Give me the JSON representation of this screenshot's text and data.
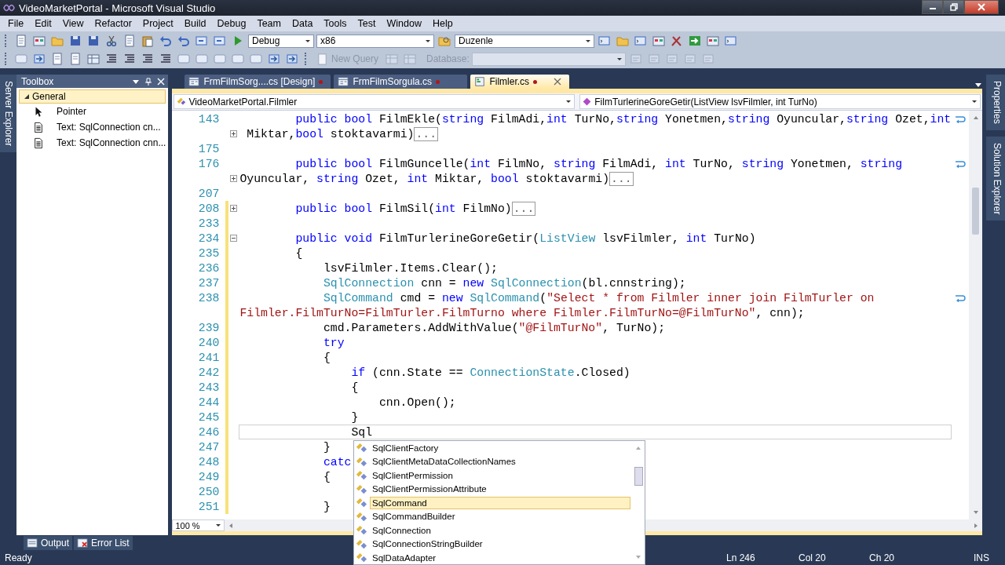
{
  "window": {
    "title": "VideoMarketPortal - Microsoft Visual Studio"
  },
  "menu": [
    "File",
    "Edit",
    "View",
    "Refactor",
    "Project",
    "Build",
    "Debug",
    "Team",
    "Data",
    "Tools",
    "Test",
    "Window",
    "Help"
  ],
  "toolbar": {
    "configuration": "Debug",
    "platform": "x86",
    "find": "Duzenle",
    "new_query": "New Query",
    "database_label": "Database:"
  },
  "side_left": [
    "Server Explorer"
  ],
  "toolbox": {
    "title": "Toolbox",
    "group": {
      "label": "General",
      "expanded": true
    },
    "items": [
      {
        "kind": "pointer",
        "label": "Pointer"
      },
      {
        "kind": "text",
        "label": "Text:  SqlConnection cn..."
      },
      {
        "kind": "text",
        "label": "Text: SqlConnection cnn..."
      }
    ]
  },
  "tabs": [
    {
      "label": "FrmFilmSorg....cs [Design]",
      "kind": "designer",
      "selected": false,
      "modified": true
    },
    {
      "label": "FrmFilmSorgula.cs",
      "kind": "designer",
      "selected": false,
      "modified": true
    },
    {
      "label": "Filmler.cs",
      "kind": "code",
      "selected": true,
      "modified": true
    }
  ],
  "nav": {
    "type": "VideoMarketPortal.Filmler",
    "member": "FilmTurlerineGoreGetir(ListView lsvFilmler, int TurNo)"
  },
  "code": [
    {
      "number": "143",
      "changed": false,
      "current": false,
      "wrapped": true,
      "segments": [
        {
          "kind": "keyword",
          "text": "        public bool"
        },
        {
          "kind": "plain",
          "text": " FilmEkle("
        },
        {
          "kind": "keyword",
          "text": "string"
        },
        {
          "kind": "plain",
          "text": " FilmAdi,"
        },
        {
          "kind": "keyword",
          "text": "int"
        },
        {
          "kind": "plain",
          "text": " TurNo,"
        },
        {
          "kind": "keyword",
          "text": "string"
        },
        {
          "kind": "plain",
          "text": " Yonetmen,"
        },
        {
          "kind": "keyword",
          "text": "string"
        },
        {
          "kind": "plain",
          "text": " Oyuncular,"
        },
        {
          "kind": "keyword",
          "text": "string"
        },
        {
          "kind": "plain",
          "text": " Ozet,"
        },
        {
          "kind": "keyword",
          "text": "int"
        }
      ]
    },
    {
      "expanded": false,
      "changed": false,
      "current": false,
      "wrapped": false,
      "segments": [
        {
          "kind": "plain",
          "text": " Miktar,"
        },
        {
          "kind": "keyword",
          "text": "bool"
        },
        {
          "kind": "plain",
          "text": " stoktavarmi)"
        },
        {
          "kind": "collapsed",
          "text": "..."
        }
      ]
    },
    {
      "number": "175",
      "changed": false,
      "current": false,
      "wrapped": false
    },
    {
      "number": "176",
      "changed": false,
      "current": false,
      "wrapped": true,
      "segments": [
        {
          "kind": "keyword",
          "text": "        public bool"
        },
        {
          "kind": "plain",
          "text": " FilmGuncelle("
        },
        {
          "kind": "keyword",
          "text": "int"
        },
        {
          "kind": "plain",
          "text": " FilmNo, "
        },
        {
          "kind": "keyword",
          "text": "string"
        },
        {
          "kind": "plain",
          "text": " FilmAdi, "
        },
        {
          "kind": "keyword",
          "text": "int"
        },
        {
          "kind": "plain",
          "text": " TurNo, "
        },
        {
          "kind": "keyword",
          "text": "string"
        },
        {
          "kind": "plain",
          "text": " Yonetmen, "
        },
        {
          "kind": "keyword",
          "text": "string"
        }
      ]
    },
    {
      "expanded": false,
      "changed": false,
      "current": false,
      "wrapped": false,
      "segments": [
        {
          "kind": "plain",
          "text": "Oyuncular, "
        },
        {
          "kind": "keyword",
          "text": "string"
        },
        {
          "kind": "plain",
          "text": " Ozet, "
        },
        {
          "kind": "keyword",
          "text": "int"
        },
        {
          "kind": "plain",
          "text": " Miktar, "
        },
        {
          "kind": "keyword",
          "text": "bool"
        },
        {
          "kind": "plain",
          "text": " stoktavarmi)"
        },
        {
          "kind": "collapsed",
          "text": "..."
        }
      ]
    },
    {
      "number": "207",
      "changed": false,
      "current": false,
      "wrapped": false
    },
    {
      "number": "208",
      "expanded": false,
      "changed": true,
      "current": false,
      "wrapped": false,
      "segments": [
        {
          "kind": "keyword",
          "text": "        public bool"
        },
        {
          "kind": "plain",
          "text": " FilmSil("
        },
        {
          "kind": "keyword",
          "text": "int"
        },
        {
          "kind": "plain",
          "text": " FilmNo)"
        },
        {
          "kind": "collapsed",
          "text": "..."
        }
      ]
    },
    {
      "number": "233",
      "changed": true,
      "current": false,
      "wrapped": false
    },
    {
      "number": "234",
      "expanded": true,
      "changed": true,
      "current": false,
      "wrapped": false,
      "segments": [
        {
          "kind": "keyword",
          "text": "        public void"
        },
        {
          "kind": "plain",
          "text": " FilmTurlerineGoreGetir("
        },
        {
          "kind": "type",
          "text": "ListView"
        },
        {
          "kind": "plain",
          "text": " lsvFilmler, "
        },
        {
          "kind": "keyword",
          "text": "int"
        },
        {
          "kind": "plain",
          "text": " TurNo)"
        }
      ]
    },
    {
      "number": "235",
      "changed": true,
      "current": false,
      "wrapped": false,
      "segments": [
        {
          "kind": "plain",
          "text": "        {"
        }
      ]
    },
    {
      "number": "236",
      "changed": true,
      "current": false,
      "wrapped": false,
      "segments": [
        {
          "kind": "plain",
          "text": "            lsvFilmler.Items.Clear();"
        }
      ]
    },
    {
      "number": "237",
      "changed": true,
      "current": false,
      "wrapped": false,
      "segments": [
        {
          "kind": "type",
          "text": "            SqlConnection"
        },
        {
          "kind": "plain",
          "text": " cnn = "
        },
        {
          "kind": "keyword",
          "text": "new"
        },
        {
          "kind": "type",
          "text": " SqlConnection"
        },
        {
          "kind": "plain",
          "text": "(bl.cnnstring);"
        }
      ]
    },
    {
      "number": "238",
      "changed": true,
      "current": false,
      "wrapped": true,
      "segments": [
        {
          "kind": "type",
          "text": "            SqlCommand"
        },
        {
          "kind": "plain",
          "text": " cmd = "
        },
        {
          "kind": "keyword",
          "text": "new"
        },
        {
          "kind": "type",
          "text": " SqlCommand"
        },
        {
          "kind": "plain",
          "text": "("
        },
        {
          "kind": "string",
          "text": "\"Select * from Filmler inner join FilmTurler on"
        }
      ]
    },
    {
      "changed": true,
      "current": false,
      "wrapped": false,
      "segments": [
        {
          "kind": "string",
          "text": "Filmler.FilmTurNo=FilmTurler.FilmTurno where Filmler.FilmTurNo=@FilmTurNo\""
        },
        {
          "kind": "plain",
          "text": ", cnn);"
        }
      ]
    },
    {
      "number": "239",
      "changed": true,
      "current": false,
      "wrapped": false,
      "segments": [
        {
          "kind": "plain",
          "text": "            cmd.Parameters.AddWithValue("
        },
        {
          "kind": "string",
          "text": "\"@FilmTurNo\""
        },
        {
          "kind": "plain",
          "text": ", TurNo);"
        }
      ]
    },
    {
      "number": "240",
      "changed": true,
      "current": false,
      "wrapped": false,
      "segments": [
        {
          "kind": "keyword",
          "text": "            try"
        }
      ]
    },
    {
      "number": "241",
      "changed": true,
      "current": false,
      "wrapped": false,
      "segments": [
        {
          "kind": "plain",
          "text": "            {"
        }
      ]
    },
    {
      "number": "242",
      "changed": true,
      "current": false,
      "wrapped": false,
      "segments": [
        {
          "kind": "keyword",
          "text": "                if"
        },
        {
          "kind": "plain",
          "text": " (cnn.State == "
        },
        {
          "kind": "type",
          "text": "ConnectionState"
        },
        {
          "kind": "plain",
          "text": ".Closed)"
        }
      ]
    },
    {
      "number": "243",
      "changed": true,
      "current": false,
      "wrapped": false,
      "segments": [
        {
          "kind": "plain",
          "text": "                {"
        }
      ]
    },
    {
      "number": "244",
      "changed": true,
      "current": false,
      "wrapped": false,
      "segments": [
        {
          "kind": "plain",
          "text": "                    cnn.Open();"
        }
      ]
    },
    {
      "number": "245",
      "changed": true,
      "current": false,
      "wrapped": false,
      "segments": [
        {
          "kind": "plain",
          "text": "                }"
        }
      ]
    },
    {
      "number": "246",
      "changed": true,
      "current": true,
      "wrapped": false,
      "segments": [
        {
          "kind": "plain",
          "text": "                Sql"
        }
      ]
    },
    {
      "number": "247",
      "changed": true,
      "current": false,
      "wrapped": false,
      "segments": [
        {
          "kind": "plain",
          "text": "            }"
        }
      ]
    },
    {
      "number": "248",
      "changed": true,
      "current": false,
      "wrapped": false,
      "segments": [
        {
          "kind": "keyword",
          "text": "            catc"
        }
      ]
    },
    {
      "number": "249",
      "changed": true,
      "current": false,
      "wrapped": false,
      "segments": [
        {
          "kind": "plain",
          "text": "            {"
        }
      ]
    },
    {
      "number": "250",
      "changed": true,
      "current": false,
      "wrapped": false
    },
    {
      "number": "251",
      "changed": true,
      "current": false,
      "wrapped": false,
      "segments": [
        {
          "kind": "plain",
          "text": "            }"
        }
      ]
    }
  ],
  "zoom": "100 %",
  "completion": [
    {
      "label": "SqlClientFactory",
      "selected": false
    },
    {
      "label": "SqlClientMetaDataCollectionNames",
      "selected": false
    },
    {
      "label": "SqlClientPermission",
      "selected": false
    },
    {
      "label": "SqlClientPermissionAttribute",
      "selected": false
    },
    {
      "label": "SqlCommand",
      "selected": true
    },
    {
      "label": "SqlCommandBuilder",
      "selected": false
    },
    {
      "label": "SqlConnection",
      "selected": false
    },
    {
      "label": "SqlConnectionStringBuilder",
      "selected": false
    },
    {
      "label": "SqlDataAdapter",
      "selected": false
    }
  ],
  "side_right": [
    "Properties",
    "Solution Explorer"
  ],
  "tool_tabs": [
    "Output",
    "Error List"
  ],
  "status": {
    "message": "Ready",
    "line": "Ln 246",
    "col": "Col 20",
    "ch": "Ch 20",
    "mode": "INS"
  }
}
